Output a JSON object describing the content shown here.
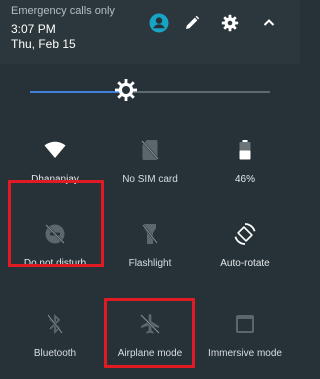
{
  "status": {
    "carrier_text": "Emergency calls only",
    "time": "3:07 PM",
    "date": "Thu, Feb 15"
  },
  "header_icons": [
    "account-icon",
    "edit-icon",
    "settings-icon",
    "collapse-chevron-icon"
  ],
  "brightness": {
    "level": 0.4
  },
  "tiles": [
    {
      "label": "Dhananjay",
      "icon": "wifi-icon",
      "active": true
    },
    {
      "label": "No SIM card",
      "icon": "no-sim-icon",
      "active": false
    },
    {
      "label": "46%",
      "icon": "battery-icon",
      "active": true
    },
    {
      "label": "Do not disturb",
      "icon": "do-not-disturb-icon",
      "active": false
    },
    {
      "label": "Flashlight",
      "icon": "flashlight-icon",
      "active": false
    },
    {
      "label": "Auto-rotate",
      "icon": "auto-rotate-icon",
      "active": true
    },
    {
      "label": "Bluetooth",
      "icon": "bluetooth-off-icon",
      "active": false
    },
    {
      "label": "Airplane mode",
      "icon": "airplane-off-icon",
      "active": false
    },
    {
      "label": "Immersive mode",
      "icon": "immersive-mode-icon",
      "active": false
    }
  ],
  "colors": {
    "accent": "#3f7fd7",
    "account": "#19a3c5",
    "highlight": "#e01b24"
  }
}
